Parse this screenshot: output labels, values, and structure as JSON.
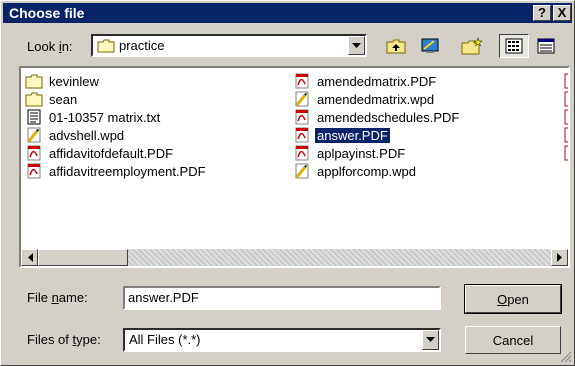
{
  "window": {
    "title": "Choose file",
    "help_label": "?",
    "close_label": "X"
  },
  "look_in": {
    "label_pre": "Look ",
    "label_key": "i",
    "label_post": "n:",
    "value": "practice"
  },
  "toolbar": {
    "buttons": [
      "up-one-level-icon",
      "desktop-icon",
      "new-folder-icon",
      "list-view-icon",
      "details-view-icon"
    ]
  },
  "files": {
    "col1": [
      {
        "name": "kevinlew",
        "icon": "folder-icon"
      },
      {
        "name": "sean",
        "icon": "folder-icon"
      },
      {
        "name": "01-10357 matrix.txt",
        "icon": "text-file-icon"
      },
      {
        "name": "advshell.wpd",
        "icon": "wpd-file-icon"
      },
      {
        "name": "affidavitofdefault.PDF",
        "icon": "pdf-file-icon"
      },
      {
        "name": "affidavitreemployment.PDF",
        "icon": "pdf-file-icon"
      }
    ],
    "col2": [
      {
        "name": "amendedmatrix.PDF",
        "icon": "pdf-file-icon"
      },
      {
        "name": "amendedmatrix.wpd",
        "icon": "wpd-file-icon"
      },
      {
        "name": "amendedschedules.PDF",
        "icon": "pdf-file-icon"
      },
      {
        "name": "answer.PDF",
        "icon": "pdf-file-icon",
        "selected": true
      },
      {
        "name": "aplpayinst.PDF",
        "icon": "pdf-file-icon"
      },
      {
        "name": "applforcomp.wpd",
        "icon": "wpd-file-icon"
      }
    ]
  },
  "file_name": {
    "label_pre": "File ",
    "label_key": "n",
    "label_post": "ame:",
    "value": "answer.PDF"
  },
  "files_of_type": {
    "label_pre": "Files of ",
    "label_key": "t",
    "label_post": "ype:",
    "value": "All Files (*.*)"
  },
  "buttons": {
    "open_key": "O",
    "open_rest": "pen",
    "cancel": "Cancel"
  },
  "colors": {
    "title_bg": "#0a246a",
    "selection": "#0a246a",
    "face": "#d4d0c8"
  }
}
